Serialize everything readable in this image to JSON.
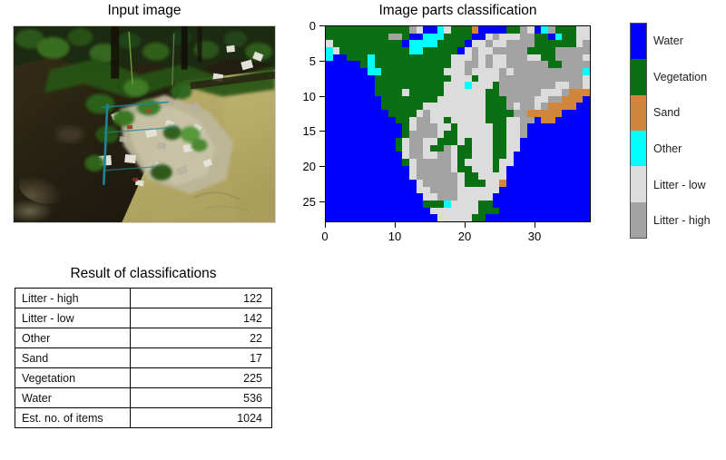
{
  "panels": {
    "input": {
      "title": "Input image"
    },
    "classification": {
      "title": "Image parts classification",
      "x_ticks": [
        "0",
        "10",
        "20",
        "30"
      ],
      "y_ticks": [
        "0",
        "5",
        "10",
        "15",
        "20",
        "25"
      ]
    },
    "results": {
      "title": "Result of classifications"
    }
  },
  "legend": {
    "items": [
      {
        "label": "Water",
        "color": "#0000ff"
      },
      {
        "label": "Vegetation",
        "color": "#0a7014"
      },
      {
        "label": "Sand",
        "color": "#d2853d"
      },
      {
        "label": "Other",
        "color": "#00ffff"
      },
      {
        "label": "Litter - low",
        "color": "#dcdcdc"
      },
      {
        "label": "Litter - high",
        "color": "#a3a3a3"
      }
    ]
  },
  "results_table": {
    "rows": [
      {
        "label": "Litter - high",
        "value": "122"
      },
      {
        "label": "Litter - low",
        "value": "142"
      },
      {
        "label": "Other",
        "value": "22"
      },
      {
        "label": "Sand",
        "value": "17"
      },
      {
        "label": "Vegetation",
        "value": "225"
      },
      {
        "label": "Water",
        "value": "536"
      },
      {
        "label": "Est. no. of items",
        "value": "1024"
      }
    ]
  },
  "chart_data": {
    "type": "heatmap",
    "title": "Image parts classification",
    "xlabel": "",
    "ylabel": "",
    "xlim": [
      0,
      38
    ],
    "ylim": [
      28,
      0
    ],
    "grid": false,
    "x_tick_values": [
      0,
      10,
      20,
      30
    ],
    "y_tick_values": [
      0,
      5,
      10,
      15,
      20,
      25
    ],
    "cols": 38,
    "rows": 28,
    "class_codes": {
      "W": "Water",
      "V": "Vegetation",
      "S": "Sand",
      "O": "Other",
      "L": "Litter - low",
      "H": "Litter - high"
    },
    "class_colors": {
      "W": "#0000ff",
      "V": "#0a7014",
      "S": "#d2853d",
      "O": "#00ffff",
      "L": "#dcdcdc",
      "H": "#a3a3a3"
    },
    "class_counts": {
      "Water": 536,
      "Vegetation": 225,
      "Litter - low": 142,
      "Litter - high": 122,
      "Other": 22,
      "Sand": 17
    },
    "estimated_items": 1024,
    "cells": [
      "VVVVVVVVVVVVHLWWOLVVVSWWWWVVHLWOHVVVLL",
      "VVVVVVVVVHHVWWOOOVVVVWWLHLLLHHVVWOVVLL",
      "LVVVVVVVVVVWOOOOVVVVWLLHLLHHHHVVVVVVLH",
      "OLVVVVVVVVVVOOVVVVVWLHLLHHHHHVVVVHHHHH",
      "OWWVVVOVVVVVVVVVVVLLLHLHLLHHHLLVVHHHHL",
      "WWWWWVOVVVVVVVVVVVLLHHLHLLHHHHHHVVHHHH",
      "WWWWWWOOVVVVVVVVVLLLHLLLLHLHHHHHHHHHHO",
      "WWWWWWWVVVVVVVVVVVLLLVLLLHHHHHHHHHHHHL",
      "WWWWWWWVVVVVVVVVVLLLOLLLVHHHHHHHHLLHHL",
      "WWWWWWWVVVVLVVVVVLLLLLLVVHHHHHHLLLHSSS",
      "WWWWWWWWVVVVVVVVLLLLLLLVVVHHHHLLHHSSSW",
      "WWWWWWWWVVVVVVLLLLLLLLLVVVHLHHLHSSSSWW",
      "WWWWWWWWWVVVVLHLLLLLLLLVVVVHHSSSSSWWWW",
      "WWWWWWWWWWVVLHHLLVLLLLLVVVLLHHWSSWWWWW",
      "WWWWWWWWWWWVLHHHLLVLLLLLVVLLHWWWWWWWWW",
      "WWWWWWWWWWWVHHHHLVVLLLLLVVLLHWWWWWWWWW",
      "WWWWWWWWWWVLHHLLVVVLVLLLVVLLWWWWWWWWWW",
      "WWWWWWWWWWVLHHLVVHLVVLLLVVLLWWWWWWWWWW",
      "WWWWWWWWWWWLHHLLHHLVVLLLVVLWWWWWWWWWWW",
      "WWWWWWWWWWWVLHHHHHLVLLLLVLLWWWWWWWWWWW",
      "WWWWWWWWWWWWLHHHHHLVVLLLVLWWWWWWWWWWWW",
      "WWWWWWWWWWWWLHHHHHHLVVLLLLWWWWWWWWWWWW",
      "WWWWWWWWWWWWWLHHHHHLVVVLLSWWWWWWWWWWWW",
      "WWWWWWWWWWWWWLLHHHHLLLLLLWWWWWWWWWWWWW",
      "WWWWWWWWWWWWWWLLHHHLLLLLWWWWWWWWWWWWWW",
      "WWWWWWWWWWWWWWVVVOLLLLVVWWWWWWWWWWWWWW",
      "WWWWWWWWWWWWWWWLLLLLLLVVVWWWWWWWWWWWWW",
      "WWWWWWWWWWWWWWWWLLLLLVVWWWWWWWWWWWWWWW"
    ]
  }
}
